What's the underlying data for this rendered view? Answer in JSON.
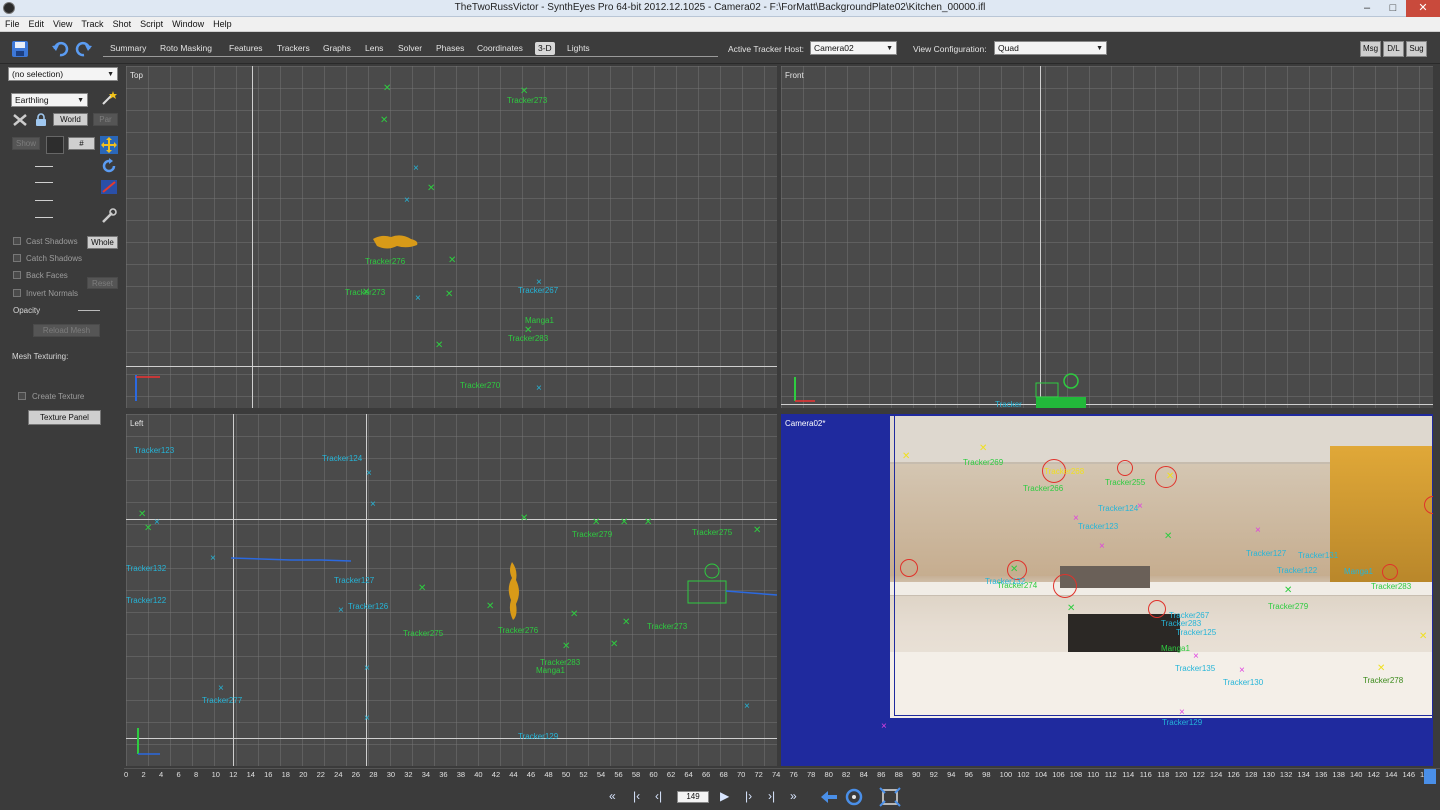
{
  "window": {
    "title": "TheTwoRussVictor - SynthEyes Pro 64-bit 2012.12.1025 - Camera02 - F:\\ForMatt\\BackgroundPlate02\\Kitchen_00000.ifl",
    "min": "–",
    "max": "□",
    "close": "✕"
  },
  "menu": [
    "File",
    "Edit",
    "View",
    "Track",
    "Shot",
    "Script",
    "Window",
    "Help"
  ],
  "tabs": [
    "Summary",
    "Roto Masking",
    "Features",
    "Trackers",
    "Graphs",
    "Lens",
    "Solver",
    "Phases",
    "Coordinates",
    "3-D",
    "Lights"
  ],
  "active_tab": "3-D",
  "toolbar": {
    "host_label": "Active Tracker Host:",
    "host_value": "Camera02",
    "view_label": "View Configuration:",
    "view_value": "Quad",
    "msg": "Msg",
    "dl": "D/L",
    "sug": "Sug"
  },
  "left": {
    "selection": "(no selection)",
    "mode": "Earthling",
    "world": "World",
    "par": "Par",
    "show": "Show",
    "hash": "#",
    "cast_shadows": "Cast Shadows",
    "whole": "Whole",
    "catch_shadows": "Catch Shadows",
    "back_faces": "Back Faces",
    "invert_normals": "Invert Normals",
    "reset": "Reset",
    "opacity": "Opacity",
    "reload_mesh": "Reload Mesh",
    "mesh_texturing": "Mesh Texturing:",
    "create_texture": "Create Texture",
    "texture_panel": "Texture Panel"
  },
  "viewports": {
    "top": "Top",
    "front": "Front",
    "left": "Left",
    "camera": "Camera02*"
  },
  "top_labels": [
    "Tracker273",
    "Tracker276",
    "Tracker273",
    "Tracker267",
    "Manga1",
    "Tracker283",
    "Tracker270"
  ],
  "front_labels": [
    "Tracker"
  ],
  "left_labels": [
    "Tracker123",
    "Tracker124",
    "Tracker132",
    "Tracker122",
    "Tracker127",
    "Tracker126",
    "Tracker275",
    "Tracker277",
    "Tracker279",
    "Tracker276",
    "Tracker283",
    "Manga1",
    "Tracker275",
    "Tracker273",
    "Tracker129"
  ],
  "cam_labels": [
    "Tracker269",
    "Tracker268",
    "Tracker266",
    "Tracker255",
    "Tracker124",
    "Tracker123",
    "Tracker127",
    "Tracker131",
    "Tracker122",
    "Manga1",
    "Tracker283",
    "Tracker274",
    "Tracker279",
    "Tracker267",
    "Tracker283",
    "Tracker125",
    "Manga1",
    "Tracker135",
    "Tracker130",
    "Tracker278",
    "Tracker129",
    "Tracker132"
  ],
  "timeline": {
    "ticks": [
      "0",
      "2",
      "4",
      "6",
      "8",
      "10",
      "12",
      "14",
      "16",
      "18",
      "20",
      "22",
      "24",
      "26",
      "28",
      "30",
      "32",
      "34",
      "36",
      "38",
      "40",
      "42",
      "44",
      "46",
      "48",
      "50",
      "52",
      "54",
      "56",
      "58",
      "60",
      "62",
      "64",
      "66",
      "68",
      "70",
      "72",
      "74",
      "76",
      "78",
      "80",
      "82",
      "84",
      "86",
      "88",
      "90",
      "92",
      "94",
      "96",
      "98",
      "100",
      "102",
      "104",
      "106",
      "108",
      "110",
      "112",
      "114",
      "116",
      "118",
      "120",
      "122",
      "124",
      "126",
      "128",
      "130",
      "132",
      "134",
      "136",
      "138",
      "140",
      "142",
      "144",
      "146",
      "148"
    ],
    "current_frame": "149"
  },
  "transport": [
    "«",
    "|‹",
    "‹|",
    "▶",
    "|›",
    "›|",
    "»"
  ]
}
